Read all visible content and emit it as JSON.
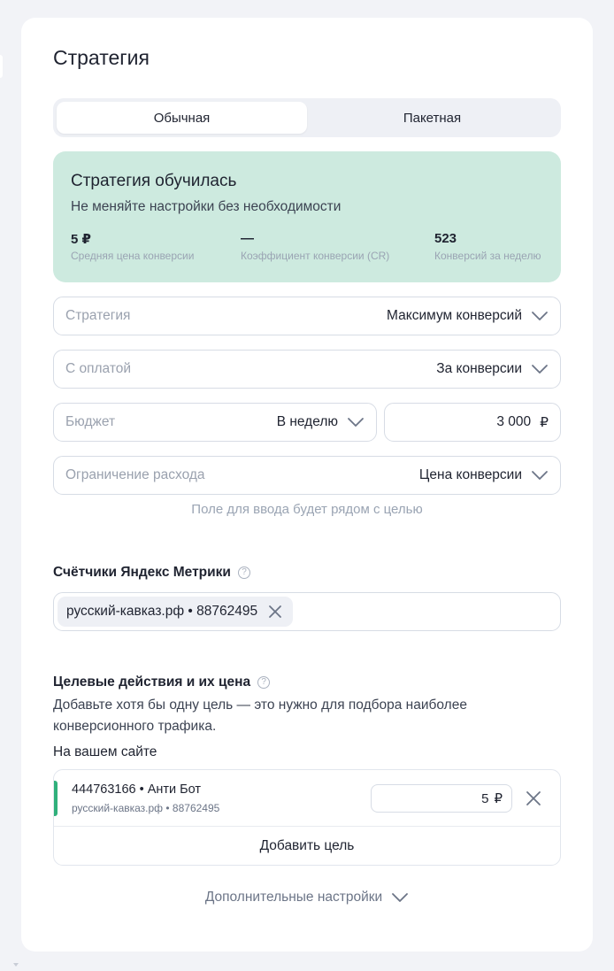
{
  "strategy": {
    "title": "Стратегия",
    "tabs": [
      {
        "label": "Обычная",
        "active": true
      },
      {
        "label": "Пакетная",
        "active": false
      }
    ],
    "status": {
      "title": "Стратегия обучилась",
      "subtitle": "Не меняйте настройки без необходимости",
      "stats": [
        {
          "value": "5 ₽",
          "label": "Средняя цена конверсии"
        },
        {
          "value": "—",
          "label": "Коэффициент конверсии (CR)"
        },
        {
          "value": "523",
          "label": "Конверсий за неделю"
        }
      ],
      "color": "#cdeadf"
    },
    "fields": {
      "strategy": {
        "label": "Стратегия",
        "value": "Максимум конверсий"
      },
      "payment": {
        "label": "С оплатой",
        "value": "За конверсии"
      },
      "budget": {
        "label": "Бюджет",
        "value": "В неделю",
        "amount": "3 000",
        "currency": "₽"
      },
      "limit": {
        "label": "Ограничение расхода",
        "value": "Цена конверсии"
      }
    },
    "limit_hint": "Поле для ввода будет рядом с целью"
  },
  "metrika": {
    "title": "Счётчики Яндекс Метрики",
    "help": "?",
    "chip": "русский-кавказ.рф • 88762495"
  },
  "goals": {
    "title": "Целевые действия и их цена",
    "help": "?",
    "description": "Добавьте хотя бы одну цель — это нужно для подбора наиболее конверсионного трафика.",
    "site_label": "На вашем сайте",
    "items": [
      {
        "name": "444763166 • Анти Бот",
        "source": "русский-кавказ.рф • 88762495",
        "price": "5",
        "currency": "₽"
      }
    ],
    "add_label": "Добавить цель",
    "accent": "#2fb07b"
  },
  "more_settings": "Дополнительные настройки"
}
